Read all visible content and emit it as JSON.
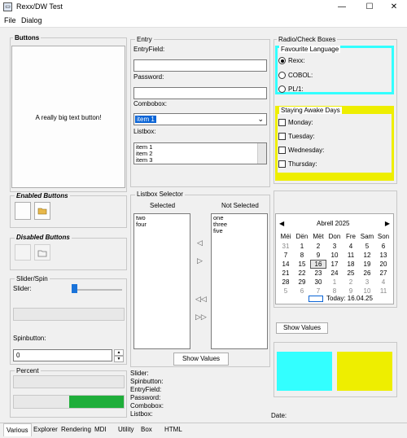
{
  "window": {
    "title": "Rexx/DW Test",
    "controls": [
      "—",
      "☐",
      "✕"
    ]
  },
  "menu": [
    "File",
    "Dialog"
  ],
  "buttons": {
    "group_label": "Buttons",
    "big_button": "A really big text button!",
    "enabled_label": "Enabled Buttons",
    "disabled_label": "Disabled Buttons"
  },
  "slider_spin": {
    "group_label": "Slider/Spin",
    "slider_label": "Slider:",
    "slider_value": 0.0,
    "spin_label": "Spinbutton:",
    "spin_value": "0"
  },
  "percent": {
    "group_label": "Percent",
    "value": 0.0,
    "value2": 0.5
  },
  "entry": {
    "group_label": "Entry",
    "entryfield_label": "EntryField:",
    "password_label": "Password:",
    "combobox_label": "Combobox:",
    "combobox_value": "item 1",
    "listbox_label": "Listbox:",
    "listbox_items": [
      "item 1",
      "item 2",
      "item 3"
    ]
  },
  "listbox_selector": {
    "group_label": "Listbox Selector",
    "selected_label": "Selected",
    "not_selected_label": "Not Selected",
    "selected_items": [
      "two",
      "four"
    ],
    "not_selected_items": [
      "one",
      "three",
      "five"
    ],
    "show_values": "Show Values"
  },
  "summary": [
    "Slider:",
    "Spinbutton:",
    "EntryField:",
    "Password:",
    "Combobox:",
    "Listbox:"
  ],
  "radio_check": {
    "group_label": "Radio/Check Boxes",
    "fav_label": "Favourite Language",
    "radios": [
      {
        "label": "Rexx:",
        "checked": true
      },
      {
        "label": "COBOL:",
        "checked": false
      },
      {
        "label": "PL/1:",
        "checked": false
      }
    ],
    "awake_label": "Staying Awake Days",
    "checks": [
      "Monday:",
      "Tuesday:",
      "Wednesday:",
      "Thursday:"
    ],
    "fav_color": "#33ffff",
    "awake_color": "#eeee00"
  },
  "calendar": {
    "month": "Abrell 2025",
    "days": [
      "Méi",
      "Dën",
      "Mët",
      "Don",
      "Fre",
      "Sam",
      "Son"
    ],
    "weeks": [
      [
        "31",
        "1",
        "2",
        "3",
        "4",
        "5",
        "6"
      ],
      [
        "7",
        "8",
        "9",
        "10",
        "11",
        "12",
        "13"
      ],
      [
        "14",
        "15",
        "16",
        "17",
        "18",
        "19",
        "20"
      ],
      [
        "21",
        "22",
        "23",
        "24",
        "25",
        "26",
        "27"
      ],
      [
        "28",
        "29",
        "30",
        "1",
        "2",
        "3",
        "4"
      ],
      [
        "5",
        "6",
        "7",
        "8",
        "9",
        "10",
        "11"
      ]
    ],
    "today_label": "Today: 16.04.25",
    "show_values": "Show Values"
  },
  "date_label": "Date:",
  "colors": {
    "cyan": "#33ffff",
    "yellow": "#eeee00",
    "green": "#1fae3a"
  },
  "tabs": [
    "Various",
    "Explorer",
    "Rendering",
    "MDI",
    "Utility",
    "Box",
    "HTML"
  ]
}
